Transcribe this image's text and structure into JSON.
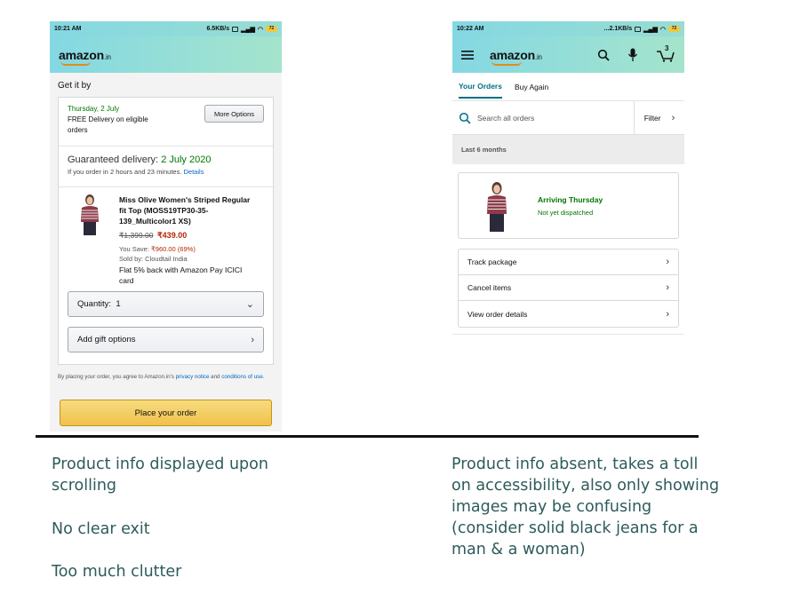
{
  "left_phone": {
    "status": {
      "time": "10:21 AM",
      "speed": "6.5KB/s",
      "battery": "72"
    },
    "logo": {
      "word": "amazon",
      "suffix": ".in"
    },
    "get_it_by": "Get it by",
    "delivery": {
      "date": "Thursday, 2 July",
      "line1": "FREE Delivery on eligible",
      "line2": "orders",
      "more_options": "More Options"
    },
    "guaranteed": {
      "label": "Guaranteed delivery:",
      "date": "2 July 2020",
      "note": "If you order in 2 hours and 23 minutes.",
      "details": "Details"
    },
    "product": {
      "name_l1": "Miss Olive Women's Striped Regular",
      "name_l2": "fit Top (MOSS19TP30-35-",
      "name_l3": "139_Multicolor1 XS)",
      "mrp": "₹1,399.00",
      "price": "₹439.00",
      "you_save_label": "You Save:",
      "you_save": "₹960.00 (69%)",
      "sold_by": "Sold by: Cloudtail India",
      "cashback_l1": "Flat 5% back with Amazon Pay ICICI",
      "cashback_l2": "card"
    },
    "quantity": {
      "label": "Quantity:",
      "value": "1"
    },
    "gift": "Add gift options",
    "legal": {
      "prefix": "By placing your order, you agree to Amazon.in's",
      "privacy": "privacy notice",
      "and": "and",
      "conditions1": "conditions",
      "conditions2": "of use."
    },
    "place_order": "Place your order"
  },
  "right_phone": {
    "status": {
      "time": "10:22 AM",
      "speed": "...2.1KB/s",
      "battery": "72"
    },
    "logo": {
      "word": "amazon",
      "suffix": ".in"
    },
    "cart_count": "3",
    "tabs": [
      "Your Orders",
      "Buy Again"
    ],
    "search_placeholder": "Search all orders",
    "filter": "Filter",
    "period": "Last 6 months",
    "order": {
      "status": "Arriving Thursday",
      "sub": "Not yet dispatched"
    },
    "actions": [
      "Track package",
      "Cancel items",
      "View order details"
    ]
  },
  "notes_left": [
    "Product info displayed upon",
    "scrolling",
    "No clear exit",
    "Too much clutter"
  ],
  "notes_right": [
    "Product info absent, takes a toll",
    "on accessibility, also only showing",
    "images may be confusing",
    "(consider solid black jeans for a",
    "man & a woman)"
  ],
  "colors": {
    "teal_header": "#84d8e3",
    "green": "#007600",
    "link": "#0066c0",
    "price_red": "#b12704",
    "note_text": "#2e5b5b",
    "button_yellow": "#f0c14b"
  }
}
